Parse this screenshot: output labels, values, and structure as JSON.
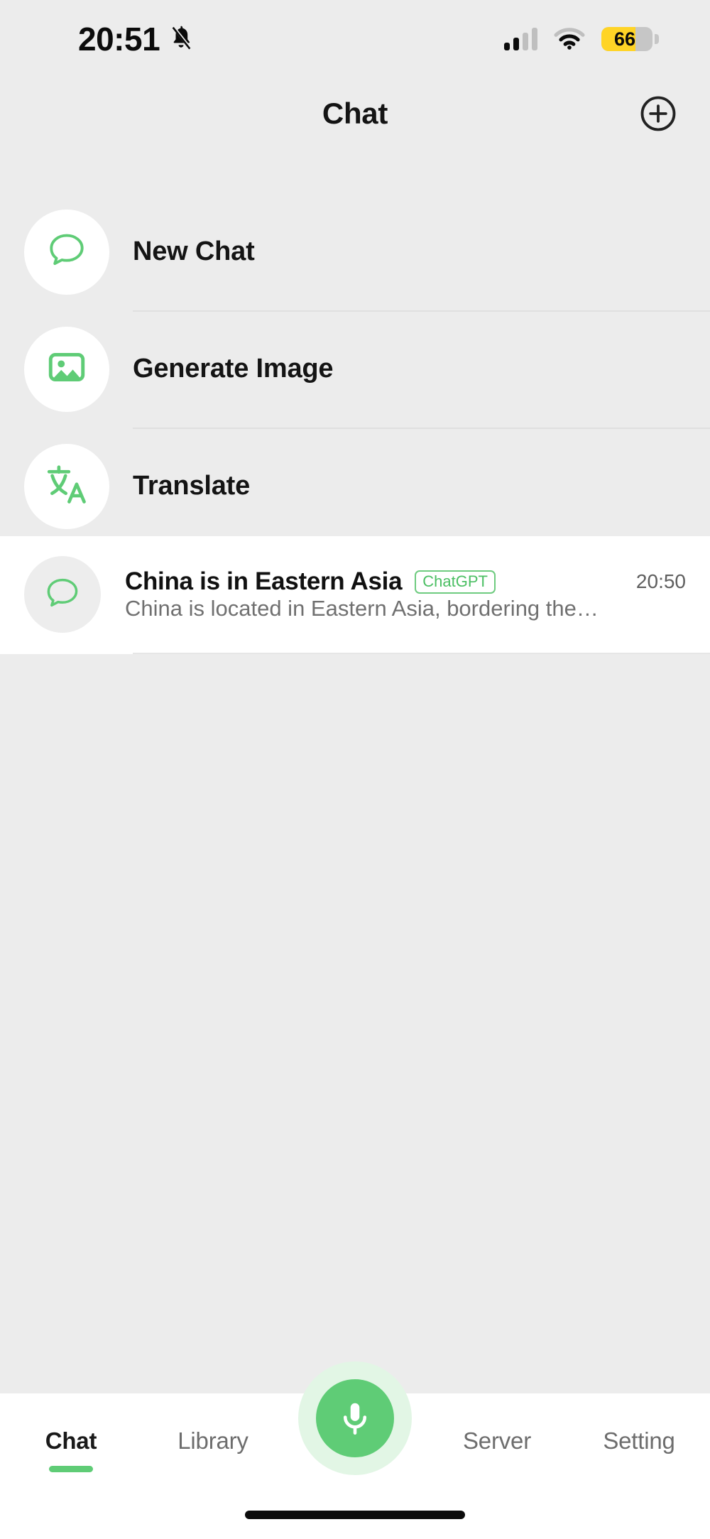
{
  "status_bar": {
    "time": "20:51",
    "mute_icon": "bell-slash-icon",
    "signal_icon": "cellular-signal-icon",
    "wifi_icon": "wifi-icon",
    "battery_percent": "66",
    "battery_level": 66,
    "battery_color": "#FFD426"
  },
  "header": {
    "title": "Chat",
    "add_icon": "plus-circle-icon"
  },
  "actions": [
    {
      "label": "New Chat",
      "icon": "chat-bubble-icon"
    },
    {
      "label": "Generate Image",
      "icon": "image-icon"
    },
    {
      "label": "Translate",
      "icon": "translate-icon"
    }
  ],
  "history": [
    {
      "title": "China is in Eastern Asia",
      "badge": "ChatGPT",
      "time": "20:50",
      "snippet": "China is located in Eastern Asia, bordering the…",
      "icon": "chat-bubble-icon"
    }
  ],
  "tab_bar": {
    "items": [
      {
        "label": "Chat",
        "active": true
      },
      {
        "label": "Library",
        "active": false
      },
      {
        "label": "Server",
        "active": false
      },
      {
        "label": "Setting",
        "active": false
      }
    ],
    "mic_icon": "microphone-icon"
  },
  "theme": {
    "accent": "#5FCC76",
    "accent_soft": "#E2F6E5",
    "background": "#ECECEC",
    "surface": "#FFFFFF"
  }
}
